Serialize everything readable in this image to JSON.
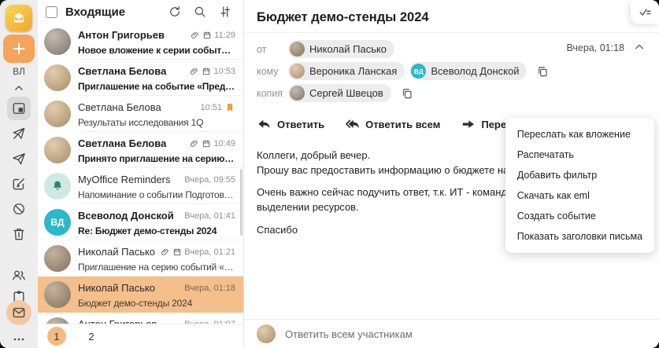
{
  "sidebar": {
    "user_initials": "ВЛ"
  },
  "list": {
    "title": "Входящие",
    "pagination": [
      "1",
      "2"
    ],
    "current_page": "1",
    "items": [
      {
        "sender": "Антон Григорьев",
        "subject": "Новое вложение к серии событий «Аналити...",
        "time": "11:29",
        "unread": true,
        "has_attachment": true,
        "has_calendar": true
      },
      {
        "sender": "Светлана Белова",
        "subject": "Приглашение на событие «Предварительно...",
        "time": "10:53",
        "unread": true,
        "has_attachment": true,
        "has_calendar": true
      },
      {
        "sender": "Светлана Белова",
        "subject": "Результаты исследования 1Q",
        "time": "10:51",
        "unread": false,
        "flagged": true
      },
      {
        "sender": "Светлана Белова",
        "subject": "Принято приглашение на серию событий «...",
        "time": "10:49",
        "unread": true,
        "has_attachment": true,
        "has_calendar": true
      },
      {
        "sender": "MyOffice Reminders",
        "subject": "Напоминание о событии Подготовить отчет...",
        "time": "Вчера, 09:55",
        "unread": false
      },
      {
        "sender": "Всеволод Донской",
        "subject": "Re: Бюджет демо-стенды 2024",
        "time": "Вчера, 01:41",
        "unread": true,
        "avatar_initials": "ВД"
      },
      {
        "sender": "Николай Пасько",
        "subject": "Приглашение на серию событий «Демо стен...",
        "time": "Вчера, 01:21",
        "unread": false,
        "has_attachment": true,
        "has_calendar": true
      },
      {
        "sender": "Николай Пасько",
        "subject": "Бюджет демо-стенды 2024",
        "time": "Вчера, 01:18",
        "unread": false,
        "selected": true
      },
      {
        "sender": "Антон Григорьев",
        "time": "Вчера, 01:07",
        "unread": false
      }
    ]
  },
  "reader": {
    "title": "Бюджет демо-стенды 2024",
    "date": "Вчера, 01:18",
    "from_label": "от",
    "from_name": "Николай Пасько",
    "to_label": "кому",
    "to": [
      "Вероника Ланская",
      "Всеволод Донской"
    ],
    "to_avatar_initials": "ВД",
    "cc_label": "копия",
    "cc": [
      "Сергей Швецов"
    ],
    "toolbar": {
      "reply": "Ответить",
      "reply_all": "Ответить всем",
      "forward": "Переслать"
    },
    "body_lines": [
      "Коллеги, добрый вечер.",
      "Прошу вас предоставить информацию о бюджете на наши демонстраци",
      "Очень важно сейчас подучить ответ, т.к. ИТ - команда Всеволода, уже",
      "выделении ресурсов.",
      "Спасибо"
    ],
    "reply_placeholder": "Ответить всем участникам"
  },
  "context_menu": {
    "items": [
      "Переслать как вложение",
      "Распечатать",
      "Добавить фильтр",
      "Скачать как eml",
      "Создать событие",
      "Показать заголовки письма"
    ]
  },
  "colors": {
    "accent": "#F5A45C",
    "selected_row": "#F5BF8B",
    "page_active_circle": "#F5BA82",
    "flag": "#F59D39",
    "avatar_vd": "#2BB8C8",
    "bell": "#2E7F7C",
    "logo_gold": "#F2AE34",
    "rail_bg": "#EDEDED"
  },
  "icons": {
    "refresh-icon": "⟳",
    "search-icon": "⌕",
    "filter-icon": "⇅",
    "paperclip-icon": "📎",
    "calendar-icon": "▤",
    "flag-icon": "🔖",
    "bell-icon": "🔔",
    "reply-icon": "↩",
    "reply-all-icon": "↞",
    "forward-icon": "➡",
    "open-in-new-icon": "⧉",
    "delete-icon": "🗑",
    "tag-icon": "🏷",
    "kebab-icon": "⋮",
    "copy-icon": "⿻",
    "checklist-icon": "✓≡",
    "chevron-up-icon": "^",
    "plus-icon": "+",
    "more-icon": "…",
    "inbox-icon": "▣",
    "sent-icon": "➤",
    "sent-cancel-icon": "➤/",
    "compose-icon": "✎",
    "spam-icon": "⊘",
    "contacts-icon": "👥",
    "tasks-icon": "▦",
    "mail-icon": "✉"
  }
}
